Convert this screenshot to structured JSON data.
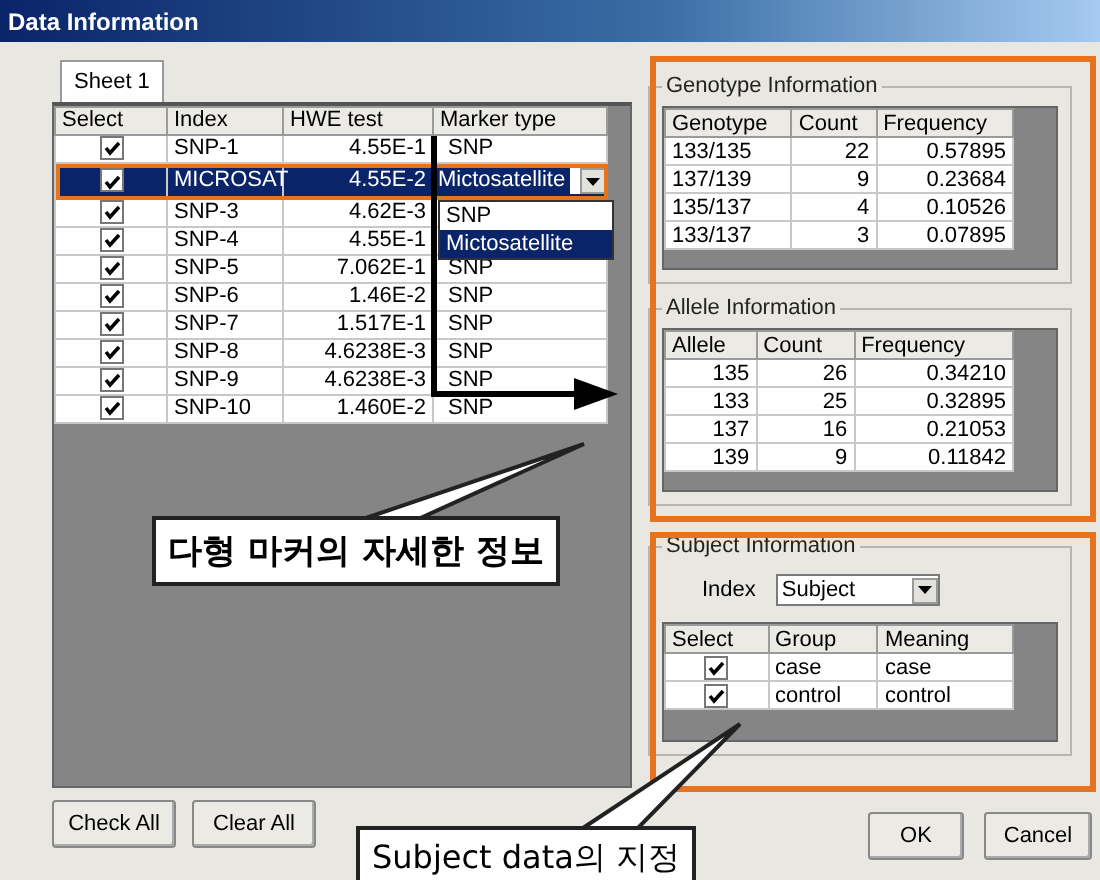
{
  "window": {
    "title": "Data Information"
  },
  "tabs": [
    {
      "label": "Sheet 1",
      "selected": true
    }
  ],
  "markers": {
    "columns": [
      "Select",
      "Index",
      "HWE test",
      "Marker type"
    ],
    "rows": [
      {
        "checked": true,
        "index": "SNP-1",
        "hwe": "4.55E-1",
        "marker": "SNP",
        "selected": false
      },
      {
        "checked": true,
        "index": "MICROSAT",
        "hwe": "4.55E-2",
        "marker": "Mictosatellite",
        "selected": true
      },
      {
        "checked": true,
        "index": "SNP-3",
        "hwe": "4.62E-3",
        "selected": false
      },
      {
        "checked": true,
        "index": "SNP-4",
        "hwe": "4.55E-1",
        "selected": false
      },
      {
        "checked": true,
        "index": "SNP-5",
        "hwe": "7.062E-1",
        "marker": "SNP",
        "selected": false
      },
      {
        "checked": true,
        "index": "SNP-6",
        "hwe": "1.46E-2",
        "marker": "SNP",
        "selected": false
      },
      {
        "checked": true,
        "index": "SNP-7",
        "hwe": "1.517E-1",
        "marker": "SNP",
        "selected": false
      },
      {
        "checked": true,
        "index": "SNP-8",
        "hwe": "4.6238E-3",
        "marker": "SNP",
        "selected": false
      },
      {
        "checked": true,
        "index": "SNP-9",
        "hwe": "4.6238E-3",
        "marker": "SNP",
        "selected": false
      },
      {
        "checked": true,
        "index": "SNP-10",
        "hwe": "1.460E-2",
        "marker": "SNP",
        "selected": false
      }
    ]
  },
  "marker_dropdown": {
    "options": [
      {
        "label": "SNP",
        "selected": false
      },
      {
        "label": "Mictosatellite",
        "selected": true
      }
    ]
  },
  "genotype": {
    "title": "Genotype Information",
    "columns": [
      "Genotype",
      "Count",
      "Frequency"
    ],
    "rows": [
      [
        "133/135",
        "22",
        "0.57895"
      ],
      [
        "137/139",
        "9",
        "0.23684"
      ],
      [
        "135/137",
        "4",
        "0.10526"
      ],
      [
        "133/137",
        "3",
        "0.07895"
      ]
    ]
  },
  "allele": {
    "title": "Allele Information",
    "columns": [
      "Allele",
      "Count",
      "Frequency"
    ],
    "rows": [
      [
        "135",
        "26",
        "0.34210"
      ],
      [
        "133",
        "25",
        "0.32895"
      ],
      [
        "137",
        "16",
        "0.21053"
      ],
      [
        "139",
        "9",
        "0.11842"
      ]
    ]
  },
  "subject": {
    "title": "Subject Information",
    "index_label": "Index",
    "index_value": "Subject",
    "columns": [
      "Select",
      "Group",
      "Meaning"
    ],
    "rows": [
      {
        "checked": true,
        "group": "case",
        "meaning": "case"
      },
      {
        "checked": true,
        "group": "control",
        "meaning": "control"
      }
    ]
  },
  "buttons_left": [
    "Check All",
    "Clear All"
  ],
  "buttons_right": [
    "OK",
    "Cancel"
  ],
  "callouts": [
    "다형 마커의 자세한 정보",
    "Subject data의 지정"
  ]
}
